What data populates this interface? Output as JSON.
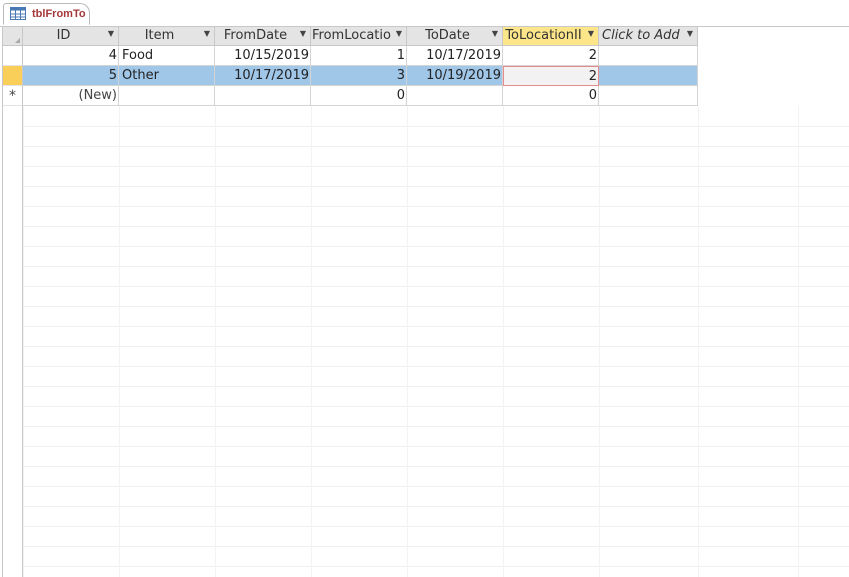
{
  "window": {
    "tab_title": "tblFromTo",
    "tab_icon": "table-icon"
  },
  "columns": [
    {
      "name": "ID",
      "dropdown": true
    },
    {
      "name": "Item",
      "dropdown": true
    },
    {
      "name": "FromDate",
      "dropdown": true
    },
    {
      "name": "FromLocatio",
      "dropdown": true
    },
    {
      "name": "ToDate",
      "dropdown": true
    },
    {
      "name": "ToLocationII",
      "dropdown": true,
      "selected": true
    },
    {
      "name": "Click to Add",
      "dropdown": true
    }
  ],
  "rows": [
    {
      "id": "4",
      "item": "Food",
      "from_date": "10/15/2019",
      "from_location": "1",
      "to_date": "10/17/2019",
      "to_location": "2",
      "current": false
    },
    {
      "id": "5",
      "item": "Other",
      "from_date": "10/17/2019",
      "from_location": "3",
      "to_date": "10/19/2019",
      "to_location": "2",
      "current": true
    }
  ],
  "new_row": {
    "marker": "*",
    "id": "(New)",
    "from_location": "0",
    "to_location": "0"
  },
  "colors": {
    "selected_row": "#a0c6e8",
    "selected_header": "#fde68a",
    "record_selector_current": "#f9cf5a",
    "tab_text": "#a4373a"
  }
}
